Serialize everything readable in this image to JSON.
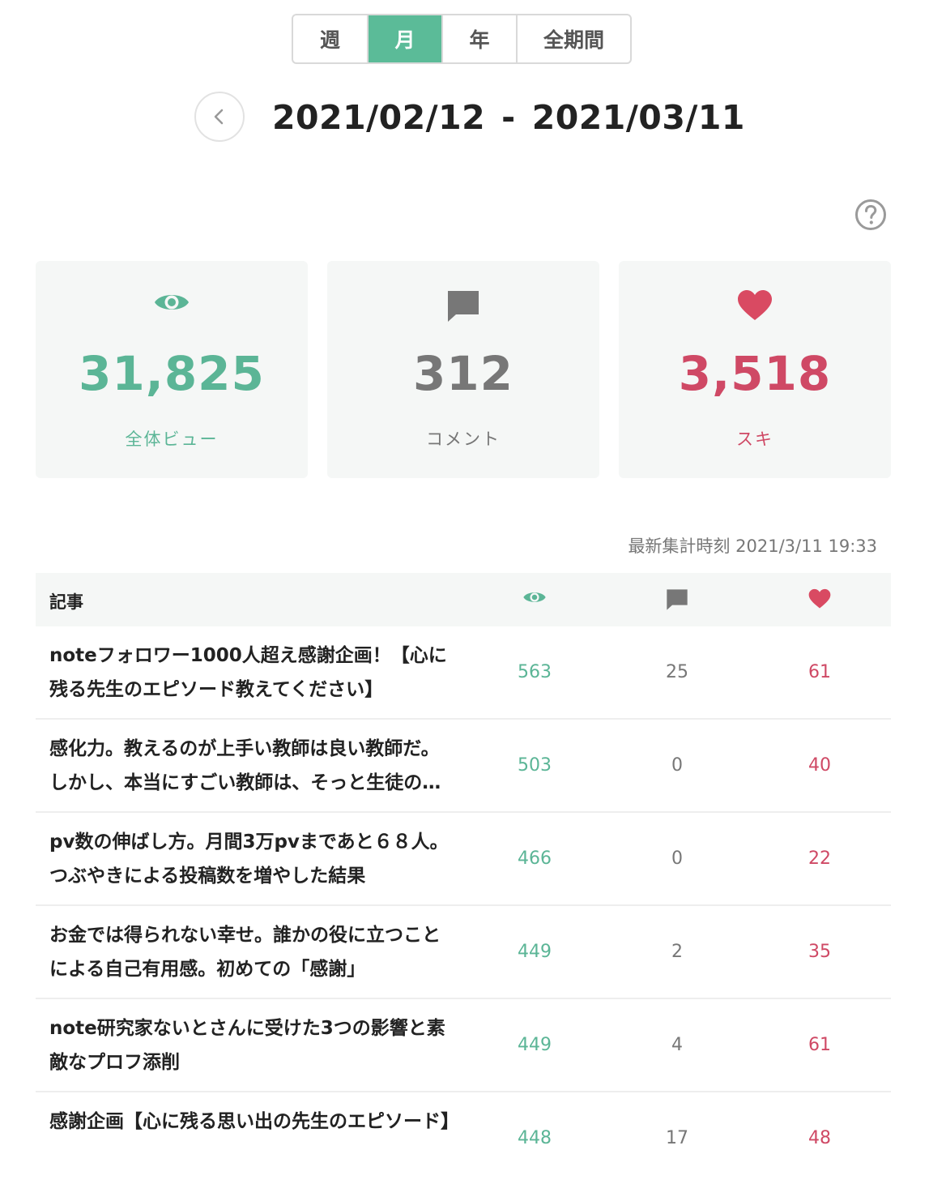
{
  "period_tabs": [
    {
      "label": "週",
      "active": false
    },
    {
      "label": "月",
      "active": true
    },
    {
      "label": "年",
      "active": false
    },
    {
      "label": "全期間",
      "active": false
    }
  ],
  "date_range": {
    "start": "2021/02/12",
    "separator": "-",
    "end": "2021/03/11"
  },
  "summary": {
    "views": {
      "value": "31,825",
      "label": "全体ビュー",
      "icon": "eye-icon"
    },
    "comments": {
      "value": "312",
      "label": "コメント",
      "icon": "comment-icon"
    },
    "likes": {
      "value": "3,518",
      "label": "スキ",
      "icon": "heart-icon"
    }
  },
  "updated": {
    "label": "最新集計時刻",
    "value": "2021/3/11 19:33"
  },
  "table": {
    "header": {
      "article": "記事"
    },
    "rows": [
      {
        "title": "noteフォロワー1000人超え感謝企画！【心に残る先生のエピソード教えてください】",
        "views": "563",
        "comments": "25",
        "likes": "61"
      },
      {
        "title": "感化力。教えるのが上手い教師は良い教師だ。しかし、本当にすごい教師は、そっと生徒の心に火をつける",
        "views": "503",
        "comments": "0",
        "likes": "40"
      },
      {
        "title": "pv数の伸ばし方。月間3万pvまであと６８人。つぶやきによる投稿数を増やした結果",
        "views": "466",
        "comments": "0",
        "likes": "22"
      },
      {
        "title": "お金では得られない幸せ。誰かの役に立つことによる自己有用感。初めての「感謝」",
        "views": "449",
        "comments": "2",
        "likes": "35"
      },
      {
        "title": "note研究家ないとさんに受けた3つの影響と素敵なプロフ添削",
        "views": "449",
        "comments": "4",
        "likes": "61"
      },
      {
        "title": "感謝企画【心に残る思い出の先生のエピソード】",
        "views": "448",
        "comments": "17",
        "likes": "48"
      }
    ]
  },
  "colors": {
    "accent_green": "#5bbb98",
    "like_red": "#cf4965",
    "comment_gray": "#777777"
  }
}
